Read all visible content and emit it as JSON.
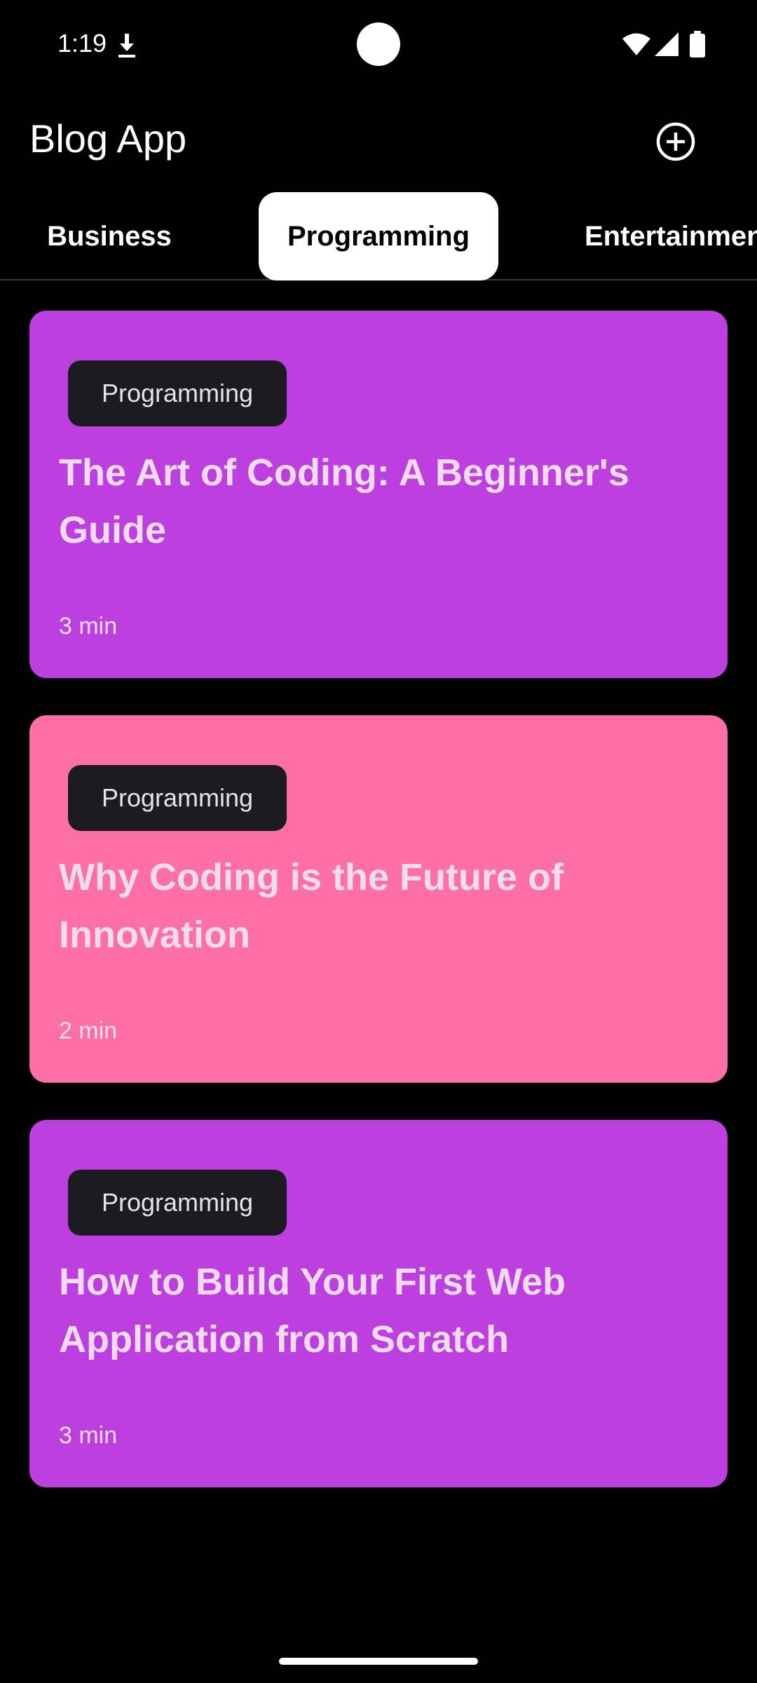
{
  "status_bar": {
    "time": "1:19",
    "icons": [
      "download-icon",
      "wifi-icon",
      "signal-icon",
      "battery-icon"
    ]
  },
  "app_bar": {
    "title": "Blog App",
    "add_icon": "add-circle-icon"
  },
  "tabs": [
    {
      "label": "Business",
      "selected": false
    },
    {
      "label": "Programming",
      "selected": true
    },
    {
      "label": "Entertainmen",
      "selected": false
    }
  ],
  "posts": [
    {
      "category": "Programming",
      "title": "The Art of Coding: A Beginner's Guide",
      "read_time": "3 min",
      "color": "#bd3fdf"
    },
    {
      "category": "Programming",
      "title": "Why Coding is the Future of Innovation",
      "read_time": "2 min",
      "color": "#fc6fa7"
    },
    {
      "category": "Programming",
      "title": "How to Build Your First Web Application from Scratch",
      "read_time": "3 min",
      "color": "#bd3fdf"
    }
  ],
  "colors": {
    "background": "#000000",
    "chip_background": "#1c1b22",
    "card_text": "#f1dcef",
    "selected_tab_background": "#ffffff"
  }
}
